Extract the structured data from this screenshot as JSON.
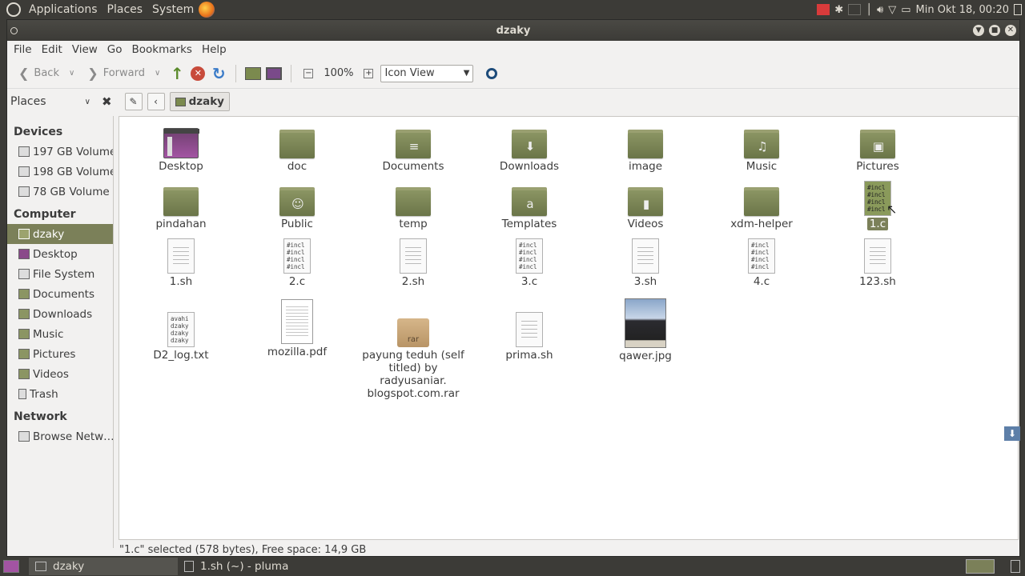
{
  "top_panel": {
    "menus": [
      "Applications",
      "Places",
      "System"
    ],
    "clock": "Min Okt 18, 00:20"
  },
  "window": {
    "title": "dzaky"
  },
  "menubar": [
    "File",
    "Edit",
    "View",
    "Go",
    "Bookmarks",
    "Help"
  ],
  "toolbar": {
    "back_label": "Back",
    "forward_label": "Forward",
    "zoom": "100%",
    "view_mode": "Icon View"
  },
  "location": {
    "places_label": "Places",
    "crumb": "dzaky"
  },
  "sidebar": {
    "devices_header": "Devices",
    "devices": [
      "197 GB Volume",
      "198 GB Volume",
      "78 GB Volume"
    ],
    "computer_header": "Computer",
    "computer": [
      "dzaky",
      "Desktop",
      "File System",
      "Documents",
      "Downloads",
      "Music",
      "Pictures",
      "Videos",
      "Trash"
    ],
    "network_header": "Network",
    "network": [
      "Browse Netw…"
    ]
  },
  "files": {
    "desktop": "Desktop",
    "doc": "doc",
    "documents": "Documents",
    "downloads": "Downloads",
    "image": "image",
    "music": "Music",
    "pictures": "Pictures",
    "pindahan": "pindahan",
    "public": "Public",
    "temp": "temp",
    "templates": "Templates",
    "videos": "Videos",
    "xdm": "xdm-helper",
    "onec": "1.c",
    "onesh": "1.sh",
    "twoc": "2.c",
    "twosh": "2.sh",
    "threec": "3.c",
    "threesh": "3.sh",
    "fourc": "4.c",
    "onetwothreesh": "123.sh",
    "d2log": "D2_log.txt",
    "mozilla": "mozilla.pdf",
    "payung": "payung teduh (self titled) by radyusaniar. blogspot.com.rar",
    "prima": "prima.sh",
    "qawer": "qawer.jpg"
  },
  "thumb_text": {
    "code": "#incl\n#incl\n#incl\n#incl",
    "log": "avahi\ndzaky\ndzaky\ndzaky",
    "rar": "rar"
  },
  "status": "\"1.c\" selected (578 bytes), Free space: 14,9 GB",
  "taskbar": {
    "task1": "dzaky",
    "task2": "1.sh (~) - pluma"
  }
}
